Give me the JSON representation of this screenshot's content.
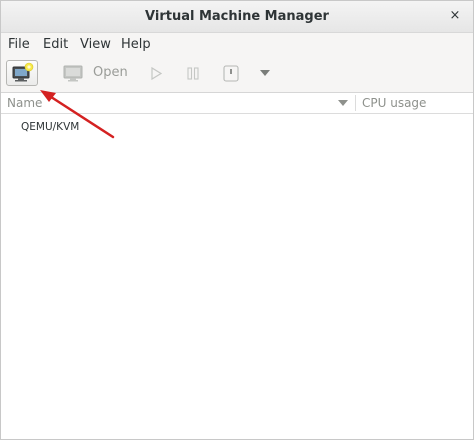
{
  "window": {
    "title": "Virtual Machine Manager",
    "close_glyph": "×"
  },
  "menu": {
    "items": [
      "File",
      "Edit",
      "View",
      "Help"
    ]
  },
  "toolbar": {
    "open_label": "Open"
  },
  "list": {
    "columns": {
      "name": "Name",
      "cpu": "CPU usage"
    },
    "rows": [
      {
        "name": "QEMU/KVM"
      }
    ]
  },
  "colors": {
    "annotation_arrow": "#d42121",
    "disabled_text": "#9a9c98",
    "text": "#2e3436"
  },
  "icons": {
    "new": "new-vm-icon",
    "open": "monitor-icon",
    "run": "play-icon",
    "pause": "pause-icon",
    "shutdown": "power-icon",
    "menu": "chevron-down-icon"
  }
}
